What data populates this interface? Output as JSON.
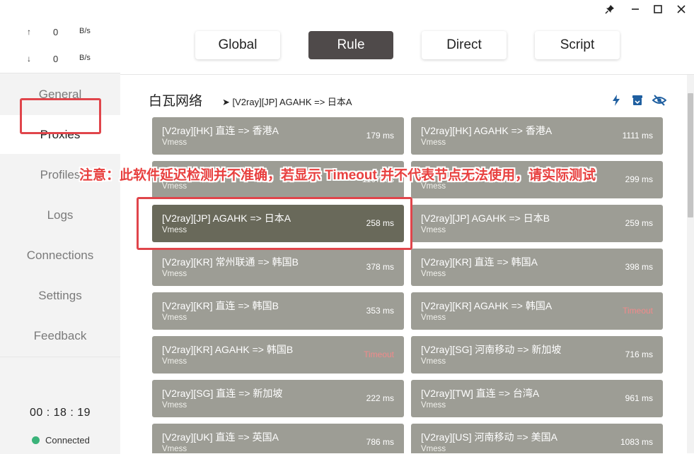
{
  "window": {
    "controls": [
      "pin-icon",
      "minimize-icon",
      "maximize-icon",
      "close-icon"
    ]
  },
  "traffic": {
    "up_arrow": "↑",
    "up_value": "0",
    "up_unit": "B/s",
    "down_arrow": "↓",
    "down_value": "0",
    "down_unit": "B/s"
  },
  "sidebar": {
    "items": [
      {
        "label": "General"
      },
      {
        "label": "Proxies"
      },
      {
        "label": "Profiles"
      },
      {
        "label": "Logs"
      },
      {
        "label": "Connections"
      },
      {
        "label": "Settings"
      },
      {
        "label": "Feedback"
      }
    ],
    "active": "Proxies",
    "timer": "00 : 18 : 19",
    "status": "Connected",
    "status_color": "#3ab37a"
  },
  "modes": [
    {
      "label": "Global"
    },
    {
      "label": "Rule"
    },
    {
      "label": "Direct"
    },
    {
      "label": "Script"
    }
  ],
  "active_mode": "Rule",
  "group": {
    "title": "白瓦网络",
    "selected": "➤ [V2ray][JP] AGAHK => 日本A",
    "tools": [
      "lightning-icon",
      "archive-icon",
      "eye-off-icon"
    ]
  },
  "proxies": [
    {
      "name": "[V2ray][HK] 直连 => 香港A",
      "type": "Vmess",
      "delay": "179 ms"
    },
    {
      "name": "[V2ray][HK] AGAHK => 香港A",
      "type": "Vmess",
      "delay": "1111 ms"
    },
    {
      "name": "",
      "type": "Vmess",
      "delay": "1107 ms"
    },
    {
      "name": "",
      "type": "Vmess",
      "delay": "299 ms"
    },
    {
      "name": "[V2ray][JP] AGAHK => 日本A",
      "type": "Vmess",
      "delay": "258 ms"
    },
    {
      "name": "[V2ray][JP] AGAHK => 日本B",
      "type": "Vmess",
      "delay": "259 ms"
    },
    {
      "name": "[V2ray][KR] 常州联通 => 韩国B",
      "type": "Vmess",
      "delay": "378 ms"
    },
    {
      "name": "[V2ray][KR] 直连 => 韩国A",
      "type": "Vmess",
      "delay": "398 ms"
    },
    {
      "name": "[V2ray][KR] 直连 => 韩国B",
      "type": "Vmess",
      "delay": "353 ms"
    },
    {
      "name": "[V2ray][KR] AGAHK => 韩国A",
      "type": "Vmess",
      "delay": "Timeout"
    },
    {
      "name": "[V2ray][KR] AGAHK => 韩国B",
      "type": "Vmess",
      "delay": "Timeout"
    },
    {
      "name": "[V2ray][SG] 河南移动 => 新加坡",
      "type": "Vmess",
      "delay": "716 ms"
    },
    {
      "name": "[V2ray][SG] 直连 => 新加坡",
      "type": "Vmess",
      "delay": "222 ms"
    },
    {
      "name": "[V2ray][TW] 直连 => 台湾A",
      "type": "Vmess",
      "delay": "961 ms"
    },
    {
      "name": "[V2ray][UK] 直连 => 英国A",
      "type": "Vmess",
      "delay": "786 ms"
    },
    {
      "name": "[V2ray][US] 河南移动 => 美国A",
      "type": "Vmess",
      "delay": "1083 ms"
    }
  ],
  "selected_proxy": "[V2ray][JP] AGAHK => 日本A",
  "notice": "注意：此软件延迟检测并不准确，若显示 Timeout 并不代表节点无法使用，请实际测试",
  "colors": {
    "card": "#9d9d95",
    "card_selected": "#69695a",
    "timeout": "#f08a8a",
    "highlight": "#e0454b",
    "active_mode": "#4f4a4a"
  }
}
